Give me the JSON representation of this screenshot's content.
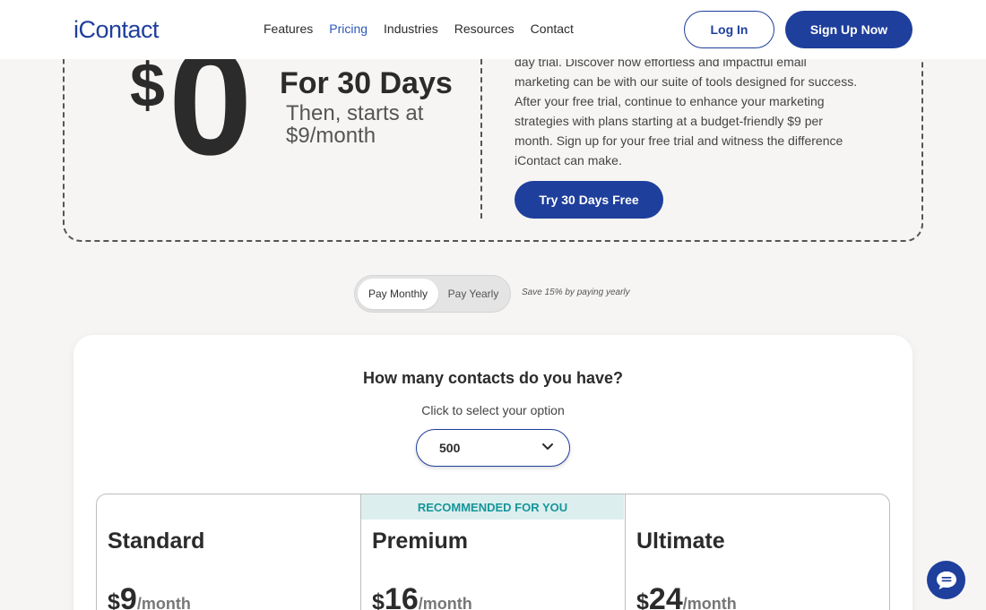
{
  "header": {
    "logo": "iContact",
    "nav": [
      "Features",
      "Pricing",
      "Industries",
      "Resources",
      "Contact"
    ],
    "login_label": "Log In",
    "signup_label": "Sign Up Now"
  },
  "promo": {
    "dollar_sign": "$",
    "amount": "0",
    "headline": "For 30 Days",
    "then": "Then, starts at $9/month",
    "body": "day trial. Discover how effortless and impactful email marketing can be with our suite of tools designed for success. After your free trial, continue to enhance your marketing strategies with plans starting at a budget-friendly $9 per month. Sign up for your free trial and witness the difference iContact can make.",
    "cta_label": "Try 30 Days Free"
  },
  "billing": {
    "monthly_label": "Pay Monthly",
    "yearly_label": "Pay Yearly",
    "save_note": "Save 15% by paying yearly"
  },
  "contacts": {
    "question": "How many contacts do you have?",
    "hint": "Click to select your option",
    "selected": "500"
  },
  "plans": {
    "recommended_label": "RECOMMENDED FOR YOU",
    "items": [
      {
        "name": "Standard",
        "currency": "$",
        "price": "9",
        "per": "/month"
      },
      {
        "name": "Premium",
        "currency": "$",
        "price": "16",
        "per": "/month"
      },
      {
        "name": "Ultimate",
        "currency": "$",
        "price": "24",
        "per": "/month"
      }
    ]
  },
  "colors": {
    "brand": "#1f3f9c",
    "accent_teal": "#15969a",
    "background": "#f6f5f3"
  },
  "icons": {
    "select": "chevron-down-icon",
    "chat": "chat-icon"
  }
}
